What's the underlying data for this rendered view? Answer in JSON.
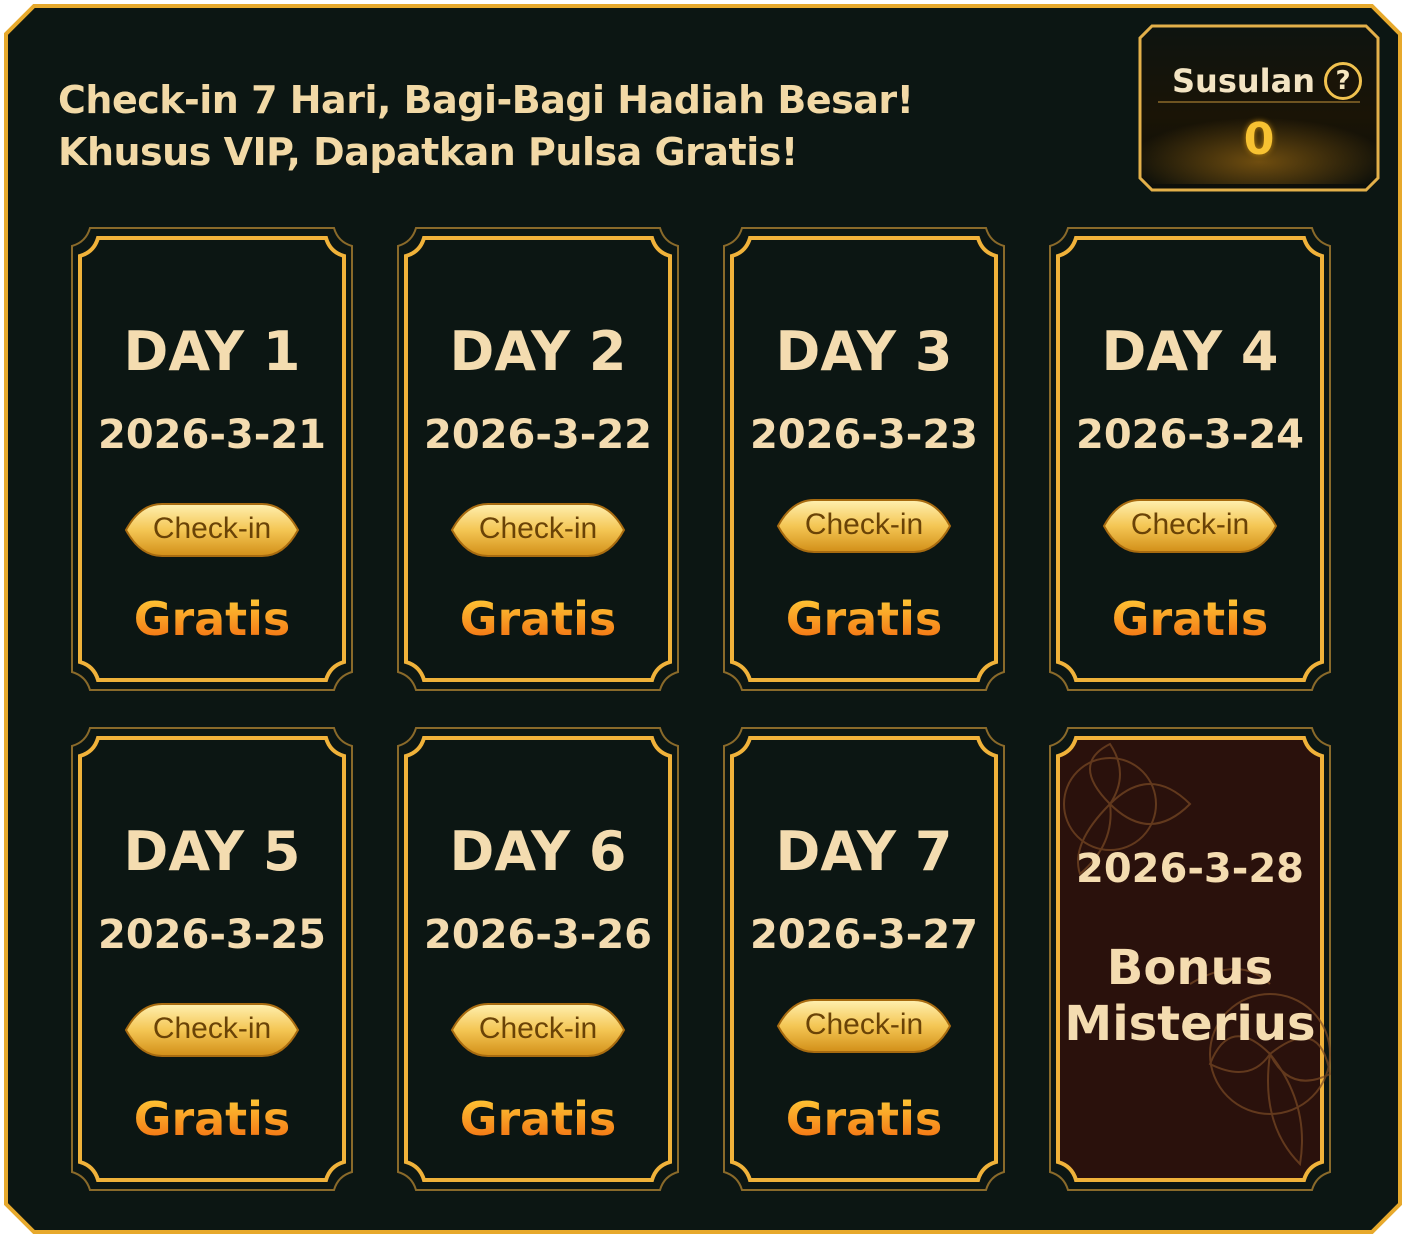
{
  "headline": {
    "line1": "Check-in 7 Hari, Bagi-Bagi Hadiah Besar!",
    "line2": "Khusus VIP, Dapatkan Pulsa Gratis!"
  },
  "susulan": {
    "label": "Susulan",
    "help_symbol": "?",
    "count": "0"
  },
  "days": [
    {
      "title": "DAY 1",
      "date": "2026-3-21",
      "button": "Check-in",
      "reward": "Gratis"
    },
    {
      "title": "DAY 2",
      "date": "2026-3-22",
      "button": "Check-in",
      "reward": "Gratis"
    },
    {
      "title": "DAY 3",
      "date": "2026-3-23",
      "button": "Check-in",
      "reward": "Gratis"
    },
    {
      "title": "DAY 4",
      "date": "2026-3-24",
      "button": "Check-in",
      "reward": "Gratis"
    },
    {
      "title": "DAY 5",
      "date": "2026-3-25",
      "button": "Check-in",
      "reward": "Gratis"
    },
    {
      "title": "DAY 6",
      "date": "2026-3-26",
      "button": "Check-in",
      "reward": "Gratis"
    },
    {
      "title": "DAY 7",
      "date": "2026-3-27",
      "button": "Check-in",
      "reward": "Gratis"
    }
  ],
  "bonus": {
    "date": "2026-3-28",
    "line1": "Bonus",
    "line2": "Misterius"
  },
  "colors": {
    "panel_bg": "#0c1613",
    "gold": "#f0b23a",
    "text_cream": "#f4dcb0",
    "bonus_bg": "#2a110c"
  }
}
